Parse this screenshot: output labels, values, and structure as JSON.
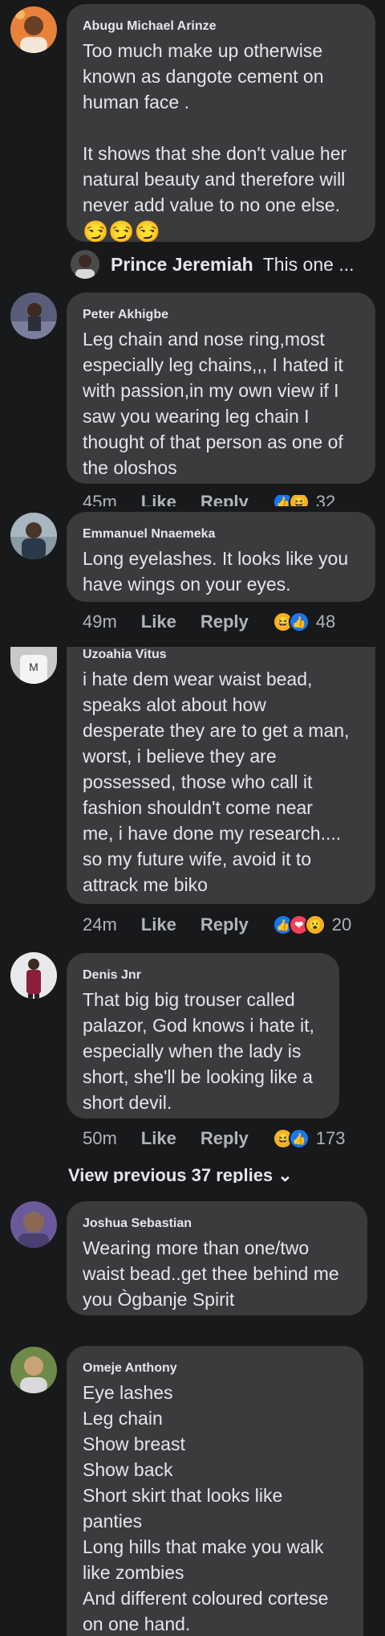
{
  "colors": {
    "bg": "#18191a",
    "bubble": "#3a3b3c",
    "text": "#e4e6eb",
    "muted": "#b0b3b8",
    "like": "#1877f2",
    "haha": "#f7b125",
    "love": "#f33e58"
  },
  "comments": [
    {
      "name": "Abugu Michael Arinze",
      "text": "Too much make up otherwise\nknown as dangote cement on\nhuman face .\n\nIt shows that she don't value her\nnatural beauty and therefore will\nnever add value to no one else.",
      "emojis": "😏😏😏"
    },
    {
      "name": "Peter Akhigbe",
      "text": "Leg chain and nose ring,most\nespecially leg chains,,, I hated it\nwith passion,in my own view if I\nsaw you wearing leg chain I\nthought of that person as one of\nthe oloshos",
      "time": "45m",
      "like": "Like",
      "reply": "Reply",
      "count": "32"
    },
    {
      "name": "Emmanuel Nnaemeka",
      "text": "Long eyelashes. It looks like you\nhave wings on your eyes.",
      "time": "49m",
      "like": "Like",
      "reply": "Reply",
      "count": "48"
    },
    {
      "name": "Uzoahia Vitus",
      "text": "i hate dem wear waist bead,\nspeaks alot about how\ndesperate they are to get a man,\nworst, i believe they are\npossessed, those who call it\nfashion shouldn't come near\nme, i have done my research....\nso my future wife, avoid it to\nattrack me biko",
      "time": "24m",
      "like": "Like",
      "reply": "Reply",
      "count": "20"
    },
    {
      "name": "Denis Jnr",
      "text": "That big big trouser called\npalazor, God knows i hate it,\nespecially when the lady is\nshort, she'll be looking like a\nshort devil.",
      "time": "50m",
      "like": "Like",
      "reply": "Reply",
      "count": "173"
    },
    {
      "name": "Joshua Sebastian",
      "text": "Wearing more than one/two\nwaist bead..get thee behind me\nyou Ògbanje Spirit"
    },
    {
      "name": "Omeje Anthony",
      "text": "Eye lashes\nLeg chain\nShow breast\nShow back\nShort skirt that looks like\npanties\nLong hills that make you walk\nlike zombies\nAnd different coloured cortese\non one hand."
    }
  ],
  "reply_preview": {
    "name": "Prince Jeremiah",
    "text": "This one ..."
  },
  "view_previous": "View previous 37 replies"
}
